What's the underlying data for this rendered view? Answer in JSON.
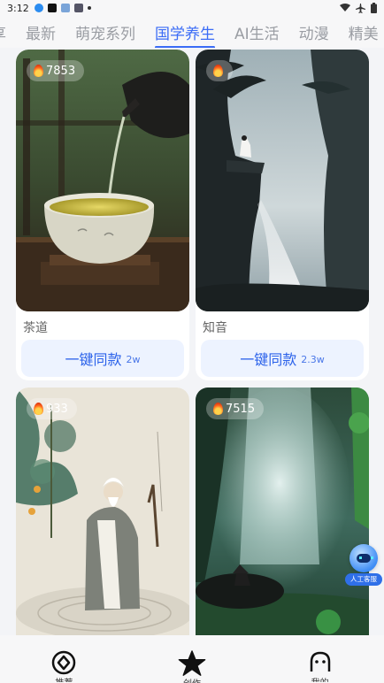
{
  "status_bar": {
    "time": "3:12"
  },
  "tabs": [
    {
      "label": "享",
      "active": false
    },
    {
      "label": "最新",
      "active": false
    },
    {
      "label": "萌宠系列",
      "active": false
    },
    {
      "label": "国学养生",
      "active": true
    },
    {
      "label": "AI生活",
      "active": false
    },
    {
      "label": "动漫",
      "active": false
    },
    {
      "label": "精美",
      "active": false
    }
  ],
  "cards": [
    {
      "title": "茶道",
      "hot_count": "7853",
      "action_label": "一键同款",
      "use_count": "2w",
      "image": "tea-pouring-scene"
    },
    {
      "title": "知音",
      "hot_count": "",
      "action_label": "一键同款",
      "use_count": "2.3w",
      "image": "cliff-waterfall-scene"
    },
    {
      "title": "",
      "hot_count": "933",
      "image": "sage-in-water-scene"
    },
    {
      "title": "",
      "hot_count": "7515",
      "image": "waterfall-boat-scene"
    }
  ],
  "support": {
    "label": "人工客服"
  },
  "bottom_nav": [
    {
      "label": "推荐",
      "icon": "compass-icon"
    },
    {
      "label": "创作",
      "icon": "star-icon"
    },
    {
      "label": "我的",
      "icon": "face-icon"
    }
  ],
  "colors": {
    "accent": "#3b6cf6",
    "button_bg": "#edf3ff"
  }
}
